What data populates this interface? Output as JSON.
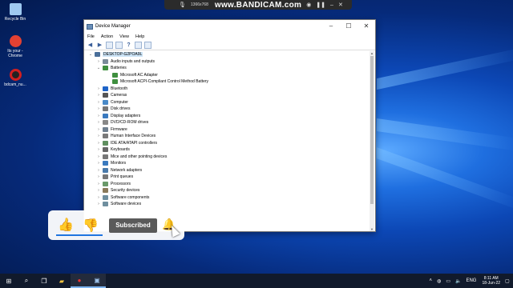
{
  "recorder": {
    "resolution": "1366x768",
    "brand": "www.BANDICAM.com"
  },
  "desktop_icons": [
    {
      "label": "Recycle Bin",
      "color": "#9ec9f0"
    },
    {
      "label": "Its your - Chrome",
      "color": "#e34133"
    },
    {
      "label": "bdcam_nu...",
      "color": "#d02020"
    }
  ],
  "window": {
    "title": "Device Manager",
    "menu": [
      "File",
      "Action",
      "View",
      "Help"
    ],
    "tree": [
      {
        "label": "DESKTOP-G2POA9L",
        "level": 0,
        "expanded": true,
        "selected": true,
        "color": "#4a6f9a"
      },
      {
        "label": "Audio inputs and outputs",
        "level": 1,
        "color": "#7a8b99"
      },
      {
        "label": "Batteries",
        "level": 1,
        "expanded": true,
        "color": "#3f8f3f"
      },
      {
        "label": "Microsoft AC Adapter",
        "level": 2,
        "color": "#3f8f3f"
      },
      {
        "label": "Microsoft ACPI-Compliant Control Method Battery",
        "level": 2,
        "color": "#3f8f3f"
      },
      {
        "label": "Bluetooth",
        "level": 1,
        "color": "#1e64c8"
      },
      {
        "label": "Cameras",
        "level": 1,
        "color": "#555555"
      },
      {
        "label": "Computer",
        "level": 1,
        "color": "#4a8ac8"
      },
      {
        "label": "Disk drives",
        "level": 1,
        "color": "#777777"
      },
      {
        "label": "Display adapters",
        "level": 1,
        "color": "#3a7abf"
      },
      {
        "label": "DVD/CD-ROM drives",
        "level": 1,
        "color": "#888888"
      },
      {
        "label": "Firmware",
        "level": 1,
        "color": "#6f7f8f"
      },
      {
        "label": "Human Interface Devices",
        "level": 1,
        "color": "#7a7a7a"
      },
      {
        "label": "IDE ATA/ATAPI controllers",
        "level": 1,
        "color": "#5f8f5f"
      },
      {
        "label": "Keyboards",
        "level": 1,
        "color": "#666666"
      },
      {
        "label": "Mice and other pointing devices",
        "level": 1,
        "color": "#777777"
      },
      {
        "label": "Monitors",
        "level": 1,
        "color": "#3a7abf"
      },
      {
        "label": "Network adapters",
        "level": 1,
        "color": "#4a7aaa"
      },
      {
        "label": "Print queues",
        "level": 1,
        "color": "#777777"
      },
      {
        "label": "Processors",
        "level": 1,
        "color": "#6a9a6a"
      },
      {
        "label": "Security devices",
        "level": 1,
        "color": "#8a7a5a"
      },
      {
        "label": "Software components",
        "level": 1,
        "color": "#6f8f9f"
      },
      {
        "label": "Software devices",
        "level": 1,
        "color": "#6f8f9f"
      }
    ]
  },
  "overlay": {
    "subscribe_label": "Subscribed"
  },
  "taskbar": {
    "lang": "ENG",
    "time": "8:11 AM",
    "date": "18-Jun-22"
  }
}
